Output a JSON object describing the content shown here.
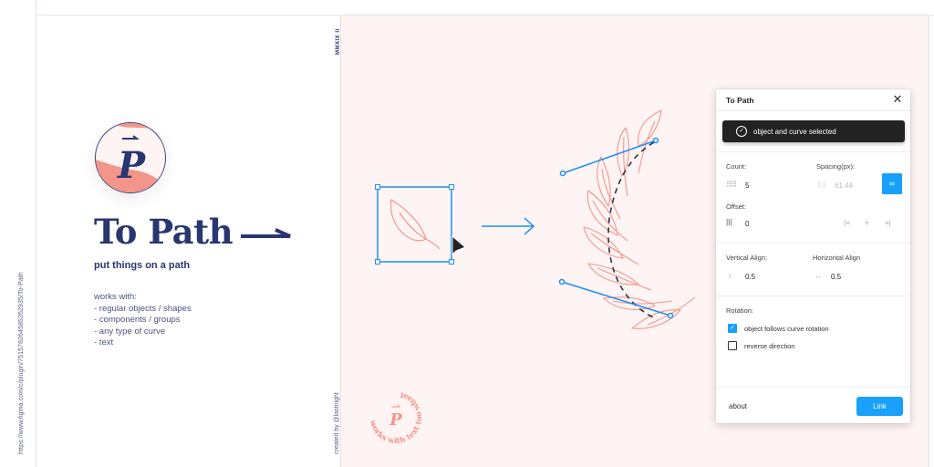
{
  "sidebar": {
    "url": "https://www.figma.com/c/plugin/751576264585262935/To-Path"
  },
  "cover": {
    "edition": "MMXIX II",
    "logo_letter": "P",
    "title": "To Path",
    "subtitle": "put things on a path",
    "works_with_heading": "works with:",
    "works_with_items": [
      "- regular objects / shapes",
      "- components / groups",
      "- any type of curve",
      "- text"
    ],
    "credit": "created by @lastnight"
  },
  "canvas": {
    "circle_text": "works with text too whaat",
    "badge_letter": "P",
    "colors": {
      "selection": "#1e8ef0",
      "leaf": "#f4958a",
      "path": "#2b3245",
      "background": "#fdf4f3"
    }
  },
  "plugin": {
    "title": "To Path",
    "close_icon": "close-icon",
    "status": {
      "icon": "check-circle-icon",
      "text": "object and curve selected"
    },
    "count": {
      "label": "Count:",
      "value": "5",
      "icon": "grid-icon"
    },
    "spacing": {
      "label": "Spacing(px):",
      "value": "61.44",
      "icon": "spacing-icon",
      "disabled": true
    },
    "link_toggle": {
      "icon": "link-icon",
      "active": true
    },
    "offset": {
      "label": "Offset:",
      "value": "0",
      "icon": "offset-icon"
    },
    "align_buttons": [
      "align-start-icon",
      "align-center-icon",
      "align-end-icon"
    ],
    "vertical_align": {
      "label": "Vertical Align:",
      "value": "0.5",
      "icon": "vertical-arrows-icon"
    },
    "horizontal_align": {
      "label": "Horizontal Align",
      "value": "0.5",
      "icon": "horizontal-arrows-icon"
    },
    "rotation": {
      "label": "Rotation:",
      "options": [
        {
          "label": "object follows curve rotation",
          "checked": true
        },
        {
          "label": "reverse direction",
          "checked": false
        }
      ]
    },
    "footer": {
      "about_label": "about",
      "primary_label": "Link"
    }
  }
}
